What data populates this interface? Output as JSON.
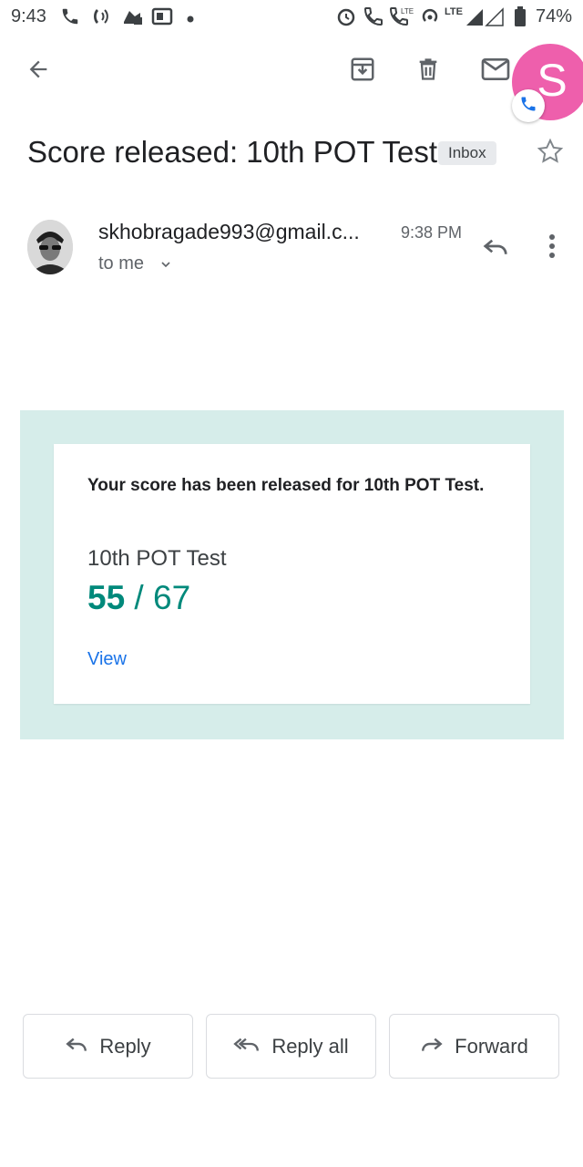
{
  "status_bar": {
    "time": "9:43",
    "battery": "74%",
    "network_label": "LTE",
    "icons": [
      "phone-icon",
      "wifi-calling-icon",
      "alarm-icon",
      "lte-call-icon",
      "hotspot-icon",
      "signal-icon",
      "battery-icon"
    ]
  },
  "toolbar": {
    "back_icon": "arrow-left-icon",
    "archive_icon": "archive-icon",
    "delete_icon": "trash-icon",
    "mark_unread_icon": "mail-icon",
    "account_initial": "S"
  },
  "email": {
    "subject": "Score released: 10th POT Test",
    "label": "Inbox",
    "sender": "skhobragade993@gmail.c...",
    "time": "9:38 PM",
    "recipient": "to me"
  },
  "card": {
    "message": "Your score has been released for 10th POT Test.",
    "test_name": "10th POT Test",
    "score": "55",
    "separator": " / ",
    "total": "67",
    "view_link": "View"
  },
  "actions": {
    "reply": "Reply",
    "reply_all": "Reply all",
    "forward": "Forward"
  },
  "colors": {
    "accent": "#00897b",
    "card_background": "#d6edea",
    "account_avatar": "#ee5fac",
    "link": "#1a73e8"
  }
}
